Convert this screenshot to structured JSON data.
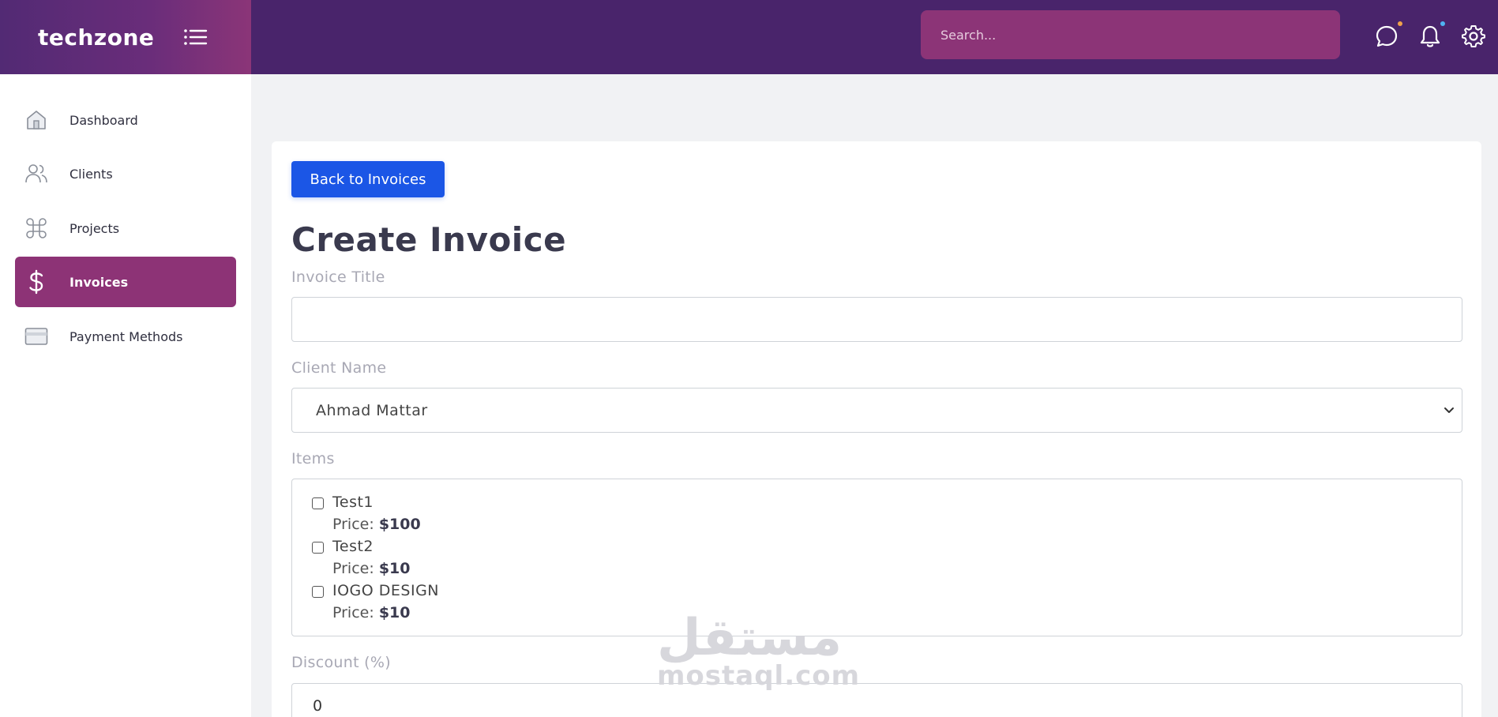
{
  "header": {
    "logo": "techzone",
    "search_placeholder": "Search...",
    "icons": [
      "menu-icon",
      "chat-icon",
      "bell-icon",
      "gear-icon"
    ],
    "colors": {
      "header_bg": "#49246b",
      "accent": "#8d3376",
      "search_bg": "#8c3477"
    }
  },
  "sidebar": {
    "items": [
      {
        "label": "Dashboard",
        "icon": "home-icon"
      },
      {
        "label": "Clients",
        "icon": "users-icon"
      },
      {
        "label": "Projects",
        "icon": "command-icon"
      },
      {
        "label": "Invoices",
        "icon": "dollar-icon",
        "active": true
      },
      {
        "label": "Payment Methods",
        "icon": "credit-card-icon"
      }
    ]
  },
  "main": {
    "back_button": "Back to Invoices",
    "title": "Create Invoice",
    "invoice_title_label": "Invoice Title",
    "invoice_title_value": "",
    "client_label": "Client Name",
    "client_selected": "Ahmad Mattar",
    "items_label": "Items",
    "price_prefix": "Price:",
    "items": [
      {
        "name": "Test1",
        "price": "$100",
        "checked": false
      },
      {
        "name": "Test2",
        "price": "$10",
        "checked": false
      },
      {
        "name": "IOGO DESIGN",
        "price": "$10",
        "checked": false
      }
    ],
    "discount_label": "Discount (%)",
    "discount_value": "0"
  },
  "watermark": {
    "arabic": "مستقل",
    "latin": "mostaql.com"
  }
}
